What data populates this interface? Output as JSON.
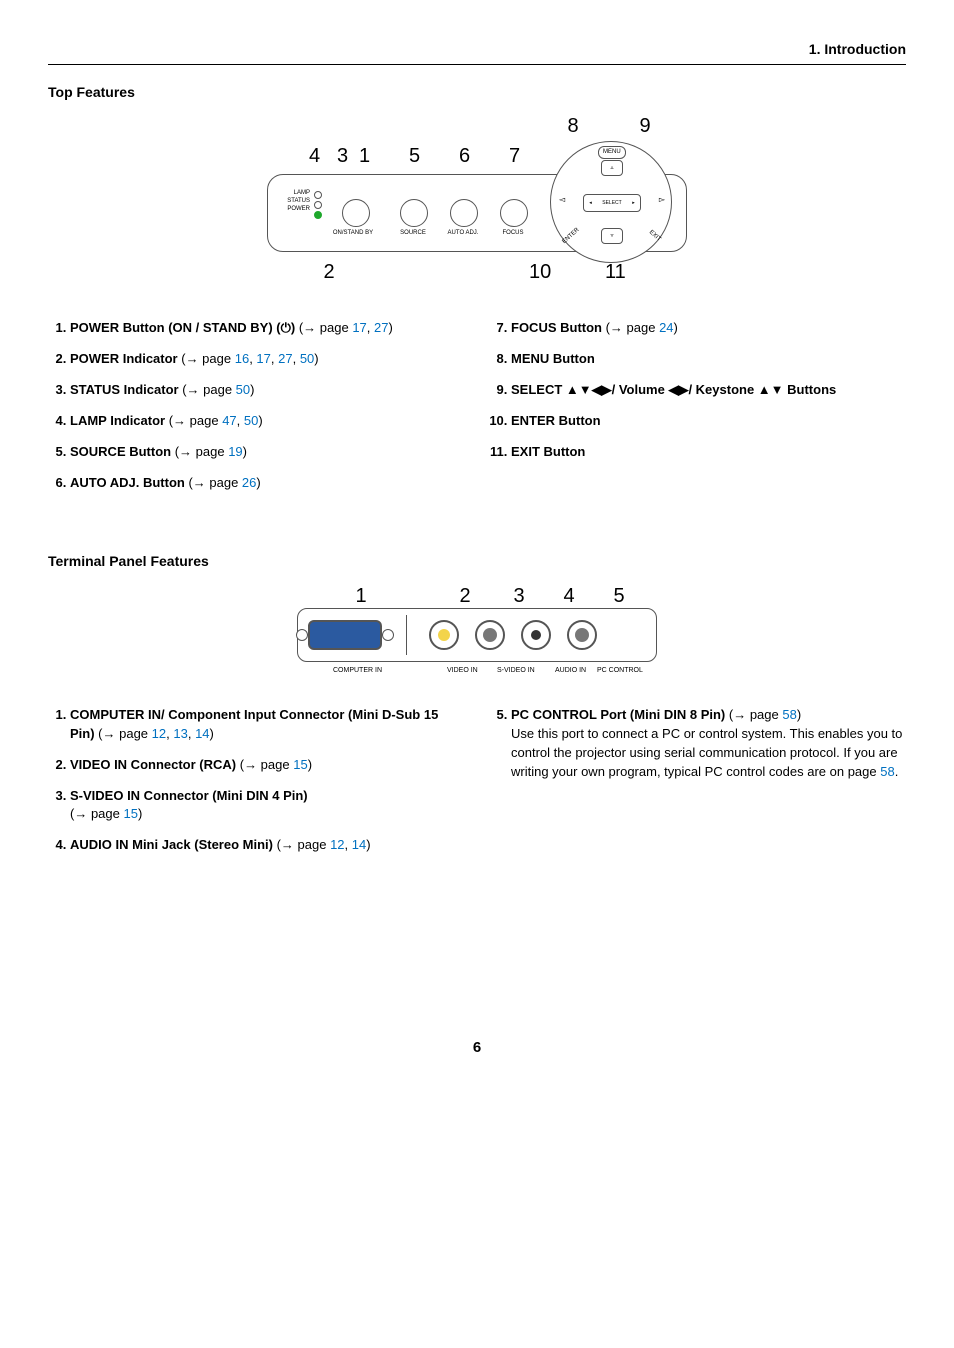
{
  "header": {
    "chapter": "1. Introduction"
  },
  "section_top": "Top Features",
  "section_terminal": "Terminal Panel Features",
  "page_number": "6",
  "diagram_top": {
    "callouts_upper": {
      "n8": "8",
      "n9": "9"
    },
    "callouts_mid": {
      "n4": "4",
      "n3": "3",
      "n1": "1",
      "n5": "5",
      "n6": "6",
      "n7": "7"
    },
    "callouts_lower": {
      "n2": "2",
      "n10": "10",
      "n11": "11"
    },
    "ind_labels": {
      "lamp": "LAMP",
      "status": "STATUS",
      "power": "POWER"
    },
    "btn_labels": {
      "onstandby": "ON/STAND BY",
      "source": "SOURCE",
      "autoadj": "AUTO ADJ.",
      "focus": "FOCUS"
    },
    "dpad": {
      "menu": "MENU",
      "select": "SELECT",
      "enter": "ENTER",
      "exit": "EXIT"
    }
  },
  "top_left": [
    {
      "bold": "POWER Button (ON / STAND BY) (⏻)",
      "tail": " (→ page ",
      "links": [
        "17",
        "27"
      ],
      "close": ")"
    },
    {
      "bold": "POWER Indicator",
      "tail": " (→ page ",
      "links": [
        "16",
        "17",
        "27",
        "50"
      ],
      "close": ")"
    },
    {
      "bold": "STATUS Indicator",
      "tail": " (→ page ",
      "links": [
        "50"
      ],
      "close": ")"
    },
    {
      "bold": "LAMP Indicator",
      "tail": " (→ page ",
      "links": [
        "47",
        "50"
      ],
      "close": ")"
    },
    {
      "bold": "SOURCE Button",
      "tail": " (→ page ",
      "links": [
        "19"
      ],
      "close": ")"
    },
    {
      "bold": "AUTO ADJ. Button",
      "tail": " (→ page ",
      "links": [
        "26"
      ],
      "close": ")"
    }
  ],
  "top_right": [
    {
      "bold": "FOCUS Button",
      "tail": " (→ page ",
      "links": [
        "24"
      ],
      "close": ")"
    },
    {
      "bold": "MENU Button",
      "tail": "",
      "links": [],
      "close": ""
    },
    {
      "bold": "SELECT ▲▼◀▶/ Volume ◀▶/ Keystone ▲▼ Buttons",
      "tail": "",
      "links": [],
      "close": ""
    },
    {
      "bold": "ENTER Button",
      "tail": "",
      "links": [],
      "close": ""
    },
    {
      "bold": "EXIT Button",
      "tail": "",
      "links": [],
      "close": ""
    }
  ],
  "diagram_term": {
    "nums": {
      "n1": "1",
      "n2": "2",
      "n3": "3",
      "n4": "4",
      "n5": "5"
    },
    "labels": {
      "computer": "COMPUTER IN",
      "video": "VIDEO IN",
      "svideo": "S-VIDEO IN",
      "audio": "AUDIO IN",
      "pcctl": "PC CONTROL"
    }
  },
  "term_left": [
    {
      "bold": "COMPUTER IN/ Component Input Connector (Mini D-Sub 15 Pin)",
      "tail": " (→ page ",
      "links": [
        "12",
        "13",
        "14"
      ],
      "close": ")"
    },
    {
      "bold": "VIDEO IN Connector (RCA)",
      "tail": " (→ page ",
      "links": [
        "15"
      ],
      "close": ")"
    },
    {
      "bold": "S-VIDEO IN Connector (Mini DIN 4 Pin)",
      "tail_pre_break": true,
      "tail": "(→ page ",
      "links": [
        "15"
      ],
      "close": ")"
    },
    {
      "bold": "AUDIO IN Mini Jack (Stereo Mini)",
      "tail": " (→ page ",
      "links": [
        "12",
        "14"
      ],
      "close": ")"
    }
  ],
  "term_right": {
    "bold": "PC CONTROL Port (Mini DIN 8 Pin)",
    "tail": " (→ page ",
    "links": [
      "58"
    ],
    "close": ")",
    "body1": "Use this port to connect a PC or control system. This enables you to control the projector using serial communication protocol. If you are writing your own program, typical PC control codes are on page ",
    "body_link": "58",
    "body2": "."
  }
}
